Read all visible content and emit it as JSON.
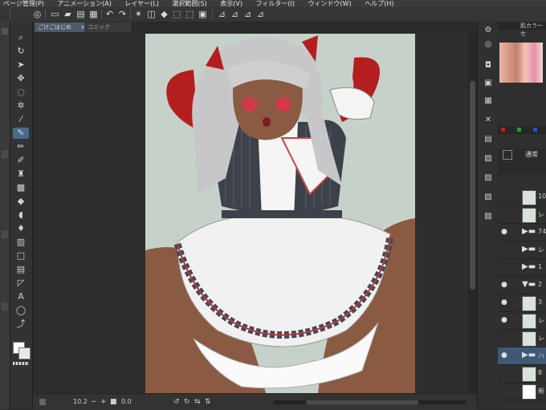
{
  "menu": [
    "ページ管理(P)",
    "アニメーション(A)",
    "レイヤー(L)",
    "選択範囲(S)",
    "表示(V)",
    "フィルター(I)",
    "ウィンドウ(W)",
    "ヘルプ(H)"
  ],
  "tabs": [
    {
      "label": "ごけごはじめ",
      "close": "×"
    },
    {
      "label": "コミック",
      "close": ""
    }
  ],
  "status": {
    "zoom": "10.2",
    "rotation": "0.0"
  },
  "color_set": {
    "title": "肌カラーセ"
  },
  "layer_panel": {
    "blend_mode": "通常",
    "layer_names": [
      "10",
      "レ",
      "74",
      "レ",
      "1",
      "2",
      "3",
      "レ",
      "レ",
      "ハ",
      "8",
      "新"
    ]
  },
  "colors": {
    "accent": "#4a6a8c",
    "paper": "#c6d2c9"
  }
}
